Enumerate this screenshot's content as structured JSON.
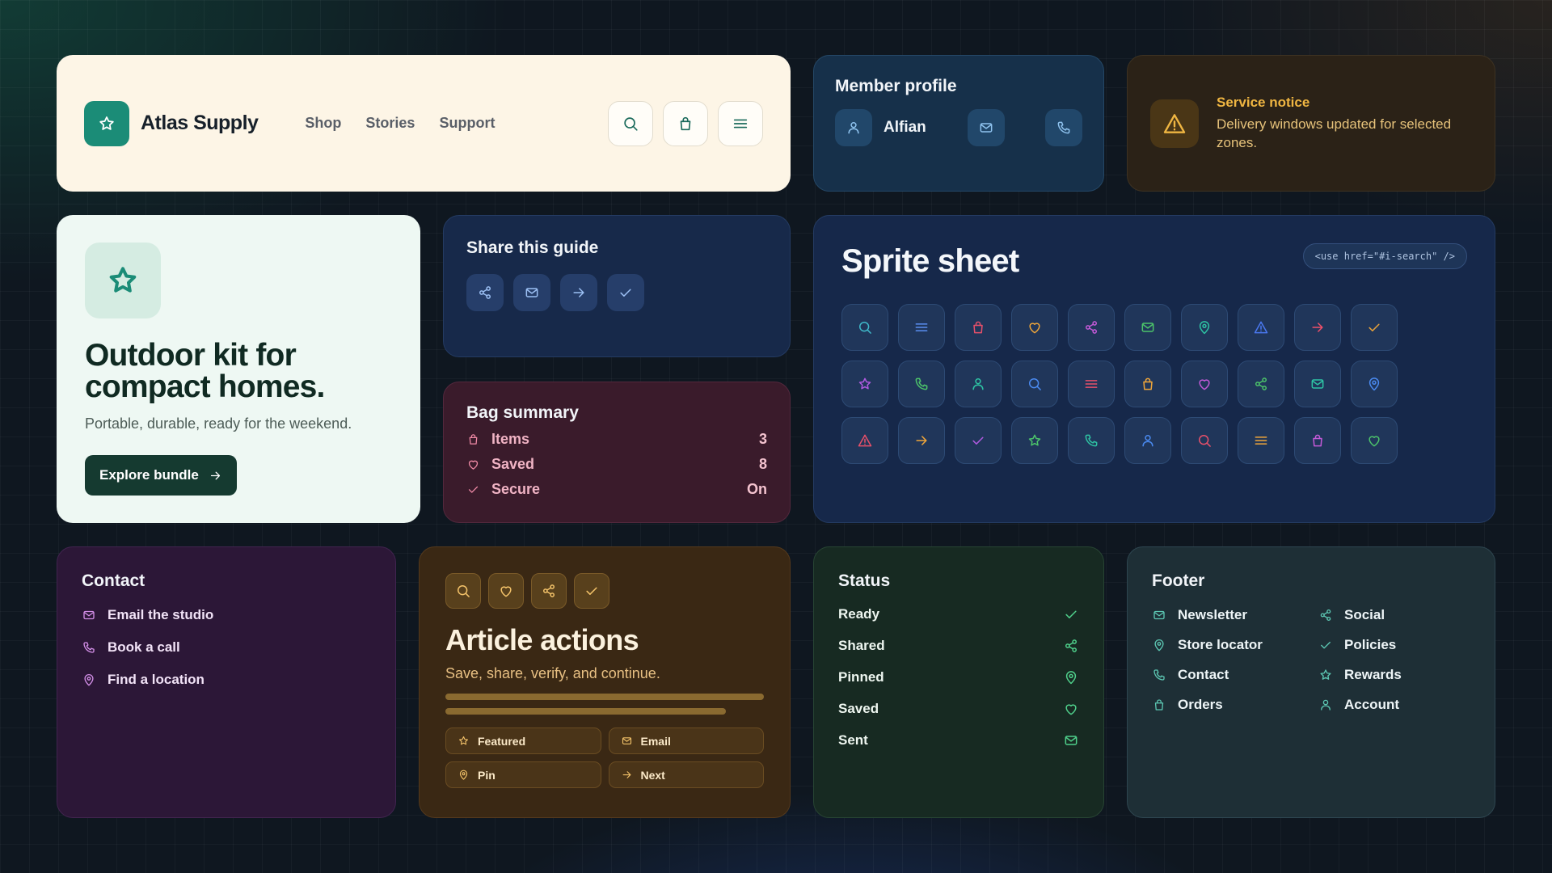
{
  "header": {
    "brand": "Atlas Supply",
    "logo_icon": "star-icon",
    "nav": [
      "Shop",
      "Stories",
      "Support"
    ],
    "actions": [
      "search-icon",
      "bag-icon",
      "menu-icon"
    ]
  },
  "profile": {
    "title": "Member profile",
    "name": "Alfian",
    "icons": [
      "user-icon",
      "mail-icon",
      "phone-icon"
    ]
  },
  "notice": {
    "title": "Service notice",
    "body": "Delivery windows updated for selected zones.",
    "icon": "warning-icon"
  },
  "hero": {
    "title": "Outdoor kit for compact homes.",
    "subtitle": "Portable, durable, ready for the weekend.",
    "cta": "Explore bundle"
  },
  "share": {
    "title": "Share this guide",
    "icons": [
      "share-icon",
      "mail-icon",
      "arrow-right-icon",
      "check-icon"
    ]
  },
  "bag": {
    "title": "Bag summary",
    "rows": [
      {
        "label": "Items",
        "value": "3",
        "icon": "bag-icon"
      },
      {
        "label": "Saved",
        "value": "8",
        "icon": "heart-icon"
      },
      {
        "label": "Secure",
        "value": "On",
        "icon": "check-icon"
      }
    ]
  },
  "sprite": {
    "title": "Sprite sheet",
    "code": "<use href=\"#i-search\" />",
    "cells": [
      {
        "icon": "search",
        "color": "#3fb8c9"
      },
      {
        "icon": "menu",
        "color": "#5a8ef0"
      },
      {
        "icon": "bag",
        "color": "#e8506a"
      },
      {
        "icon": "heart",
        "color": "#f0a63a"
      },
      {
        "icon": "share",
        "color": "#c45ad8"
      },
      {
        "icon": "mail",
        "color": "#4cc46a"
      },
      {
        "icon": "pin",
        "color": "#2ec4a4"
      },
      {
        "icon": "warning",
        "color": "#4a78f0"
      },
      {
        "icon": "arrow",
        "color": "#f0506a"
      },
      {
        "icon": "check",
        "color": "#e8a23a"
      },
      {
        "icon": "star",
        "color": "#b05ae0"
      },
      {
        "icon": "phone",
        "color": "#4cc46a"
      },
      {
        "icon": "user",
        "color": "#2ec4a4"
      },
      {
        "icon": "search",
        "color": "#4a8af0"
      },
      {
        "icon": "menu",
        "color": "#e8506a"
      },
      {
        "icon": "bag",
        "color": "#f0a63a"
      },
      {
        "icon": "heart",
        "color": "#c45ad8"
      },
      {
        "icon": "share",
        "color": "#4cc46a"
      },
      {
        "icon": "mail",
        "color": "#2ec4a4"
      },
      {
        "icon": "pin",
        "color": "#4a8af0"
      },
      {
        "icon": "warning",
        "color": "#e8506a"
      },
      {
        "icon": "arrow",
        "color": "#f0a63a"
      },
      {
        "icon": "check",
        "color": "#b05ae0"
      },
      {
        "icon": "star",
        "color": "#4cc46a"
      },
      {
        "icon": "phone",
        "color": "#2ec4a4"
      },
      {
        "icon": "user",
        "color": "#4a8af0"
      },
      {
        "icon": "search",
        "color": "#e8506a"
      },
      {
        "icon": "menu",
        "color": "#f0a63a"
      },
      {
        "icon": "bag",
        "color": "#c45ad8"
      },
      {
        "icon": "heart",
        "color": "#4cc46a"
      }
    ]
  },
  "contact": {
    "title": "Contact",
    "links": [
      {
        "label": "Email the studio",
        "icon": "mail-icon"
      },
      {
        "label": "Book a call",
        "icon": "phone-icon"
      },
      {
        "label": "Find a location",
        "icon": "pin-icon"
      }
    ]
  },
  "article": {
    "title": "Article actions",
    "subtitle": "Save, share, verify, and continue.",
    "icons": [
      "search-icon",
      "heart-icon",
      "share-icon",
      "check-icon"
    ],
    "tags": [
      {
        "label": "Featured",
        "icon": "star-icon"
      },
      {
        "label": "Email",
        "icon": "mail-icon"
      },
      {
        "label": "Pin",
        "icon": "pin-icon"
      },
      {
        "label": "Next",
        "icon": "arrow-right-icon"
      }
    ]
  },
  "status": {
    "title": "Status",
    "rows": [
      {
        "label": "Ready",
        "icon": "check-icon"
      },
      {
        "label": "Shared",
        "icon": "share-icon"
      },
      {
        "label": "Pinned",
        "icon": "pin-icon"
      },
      {
        "label": "Saved",
        "icon": "heart-icon"
      },
      {
        "label": "Sent",
        "icon": "mail-icon"
      }
    ]
  },
  "footer": {
    "title": "Footer",
    "links": [
      {
        "label": "Newsletter",
        "icon": "mail-icon"
      },
      {
        "label": "Social",
        "icon": "share-icon"
      },
      {
        "label": "Store locator",
        "icon": "pin-icon"
      },
      {
        "label": "Policies",
        "icon": "check-icon"
      },
      {
        "label": "Contact",
        "icon": "phone-icon"
      },
      {
        "label": "Rewards",
        "icon": "star-icon"
      },
      {
        "label": "Orders",
        "icon": "bag-icon"
      },
      {
        "label": "Account",
        "icon": "user-icon"
      }
    ]
  }
}
